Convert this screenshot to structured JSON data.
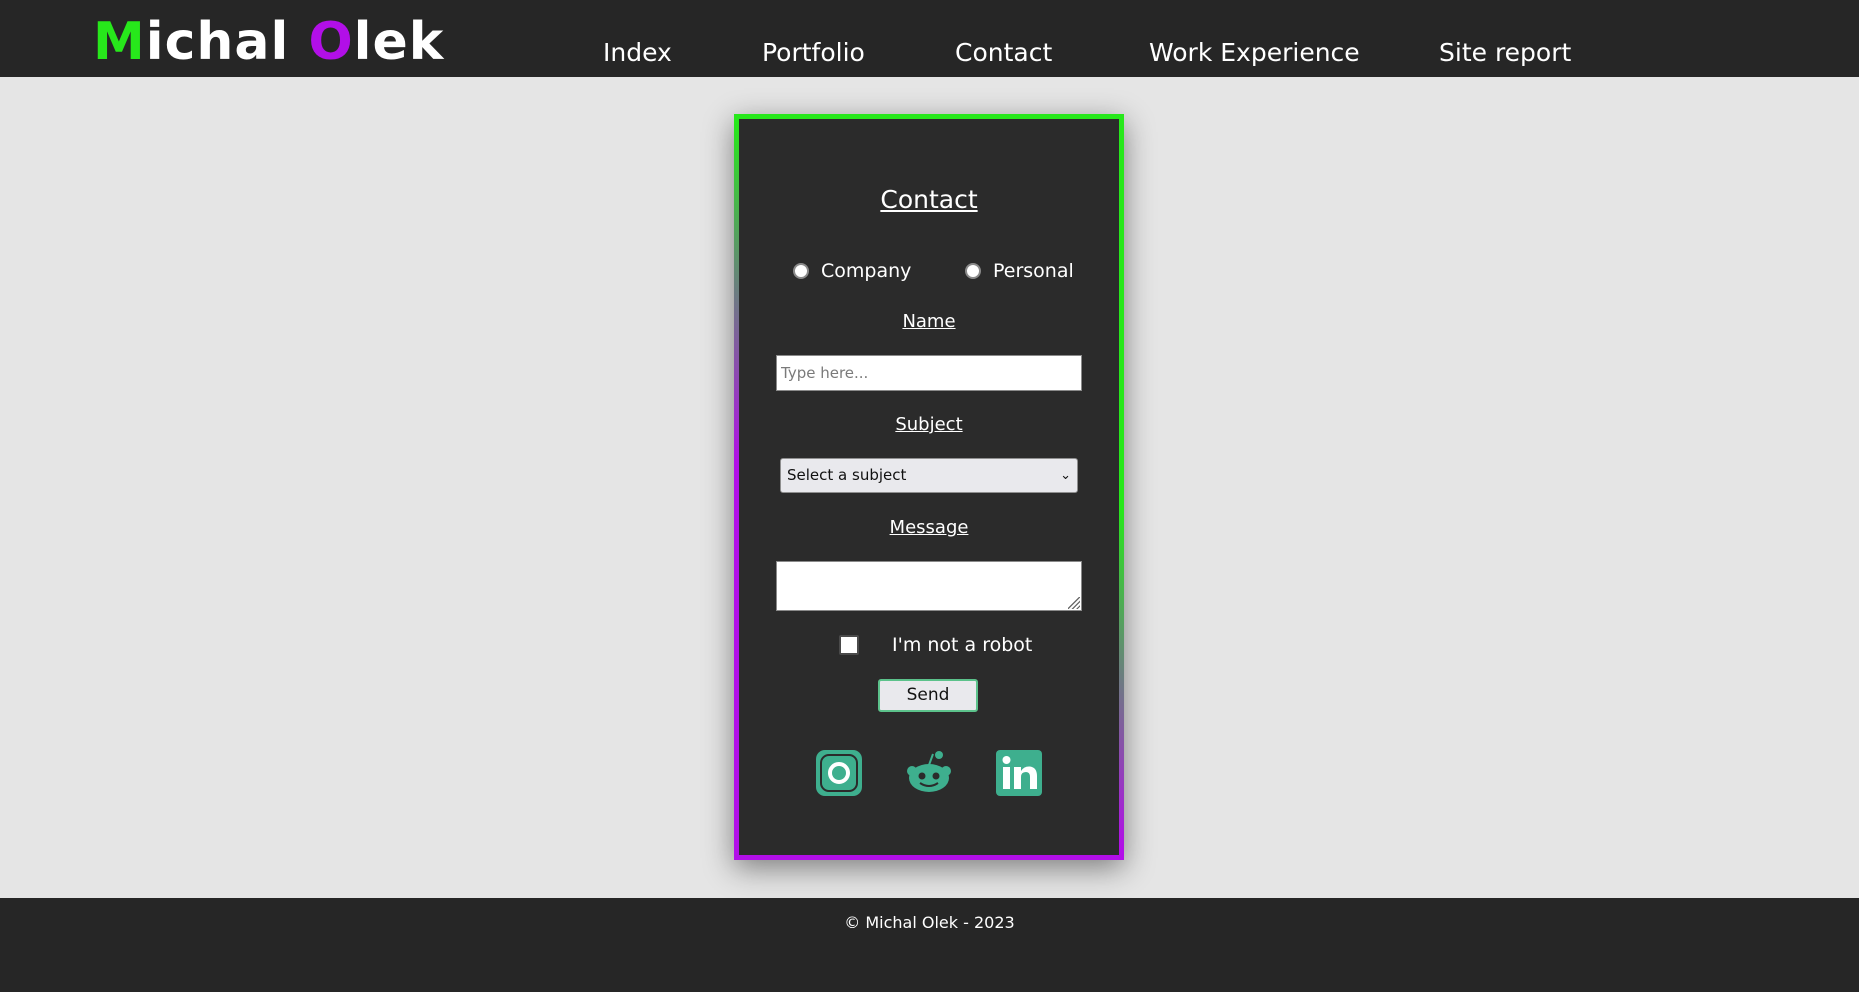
{
  "header": {
    "logo": {
      "part1": "M",
      "part2": "ichal ",
      "part3": "O",
      "part4": "lek"
    },
    "nav": [
      "Index",
      "Portfolio",
      "Contact",
      "Work Experience",
      "Site report"
    ]
  },
  "form": {
    "title": "Contact",
    "type_options": [
      "Company",
      "Personal"
    ],
    "name_label": "Name",
    "name_placeholder": "Type here...",
    "name_value": "",
    "subject_label": "Subject",
    "subject_selected": "Select a subject",
    "message_label": "Message",
    "message_value": "",
    "robot_label": "I'm not a robot",
    "robot_checked": false,
    "send_label": "Send"
  },
  "social": [
    "instagram-icon",
    "reddit-icon",
    "linkedin-icon"
  ],
  "footer": {
    "copyright": "© Michal Olek - 2023"
  },
  "colors": {
    "accent_green": "#27e81b",
    "accent_purple": "#b20fe8",
    "social_teal": "#3eaf8e",
    "header_bg": "#262626",
    "card_bg": "#2b2b2b",
    "page_bg": "#e5e5e5"
  }
}
